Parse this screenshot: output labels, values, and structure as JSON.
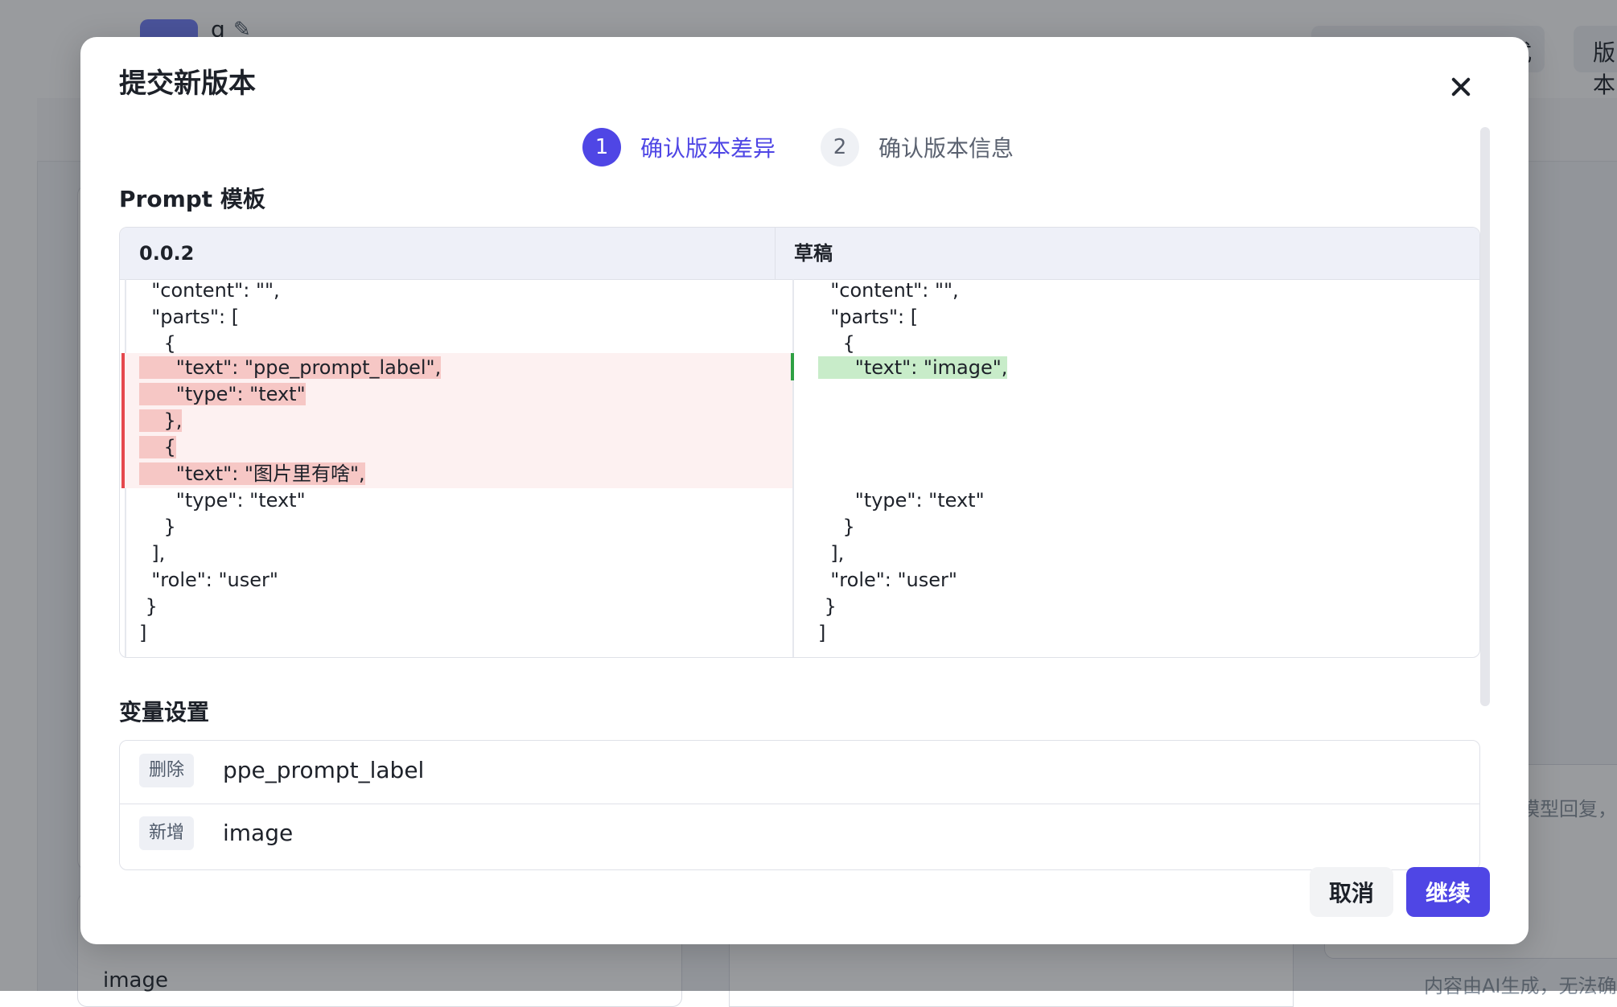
{
  "background": {
    "app_title": "g",
    "header_button_1": "式",
    "header_button_2": "版本",
    "image_label": "image",
    "right_hint": "模型回复，",
    "footer_note": "内容由AI生成，无法确"
  },
  "modal": {
    "title": "提交新版本",
    "steps": [
      {
        "number": "1",
        "label": "确认版本差异",
        "active": true
      },
      {
        "number": "2",
        "label": "确认版本信息",
        "active": false
      }
    ],
    "prompt_section_title": "Prompt 模板",
    "diff": {
      "left_header": "0.0.2",
      "right_header": "草稿",
      "left_lines": [
        "  \"content\": \"\",",
        "  \"parts\": [",
        "    {",
        "      \"text\": \"ppe_prompt_label\",",
        "      \"type\": \"text\"",
        "    },",
        "    {",
        "      \"text\": \"图片里有啥\",",
        "      \"type\": \"text\"",
        "    }",
        "  ],",
        "  \"role\": \"user\"",
        " }",
        "]"
      ],
      "right_lines": [
        "  \"content\": \"\",",
        "  \"parts\": [",
        "    {",
        "      \"text\": \"image\",",
        "",
        "",
        "",
        "",
        "      \"type\": \"text\"",
        "    }",
        "  ],",
        "  \"role\": \"user\"",
        " }",
        "]"
      ]
    },
    "variables_section_title": "变量设置",
    "variables": [
      {
        "tag": "删除",
        "name": "ppe_prompt_label"
      },
      {
        "tag": "新增",
        "name": "image"
      }
    ],
    "buttons": {
      "cancel": "取消",
      "continue": "继续"
    }
  },
  "colors": {
    "accent": "#4f46e5",
    "deleted_highlight": "#f6c7c5",
    "added_highlight": "#c8ecc9"
  }
}
